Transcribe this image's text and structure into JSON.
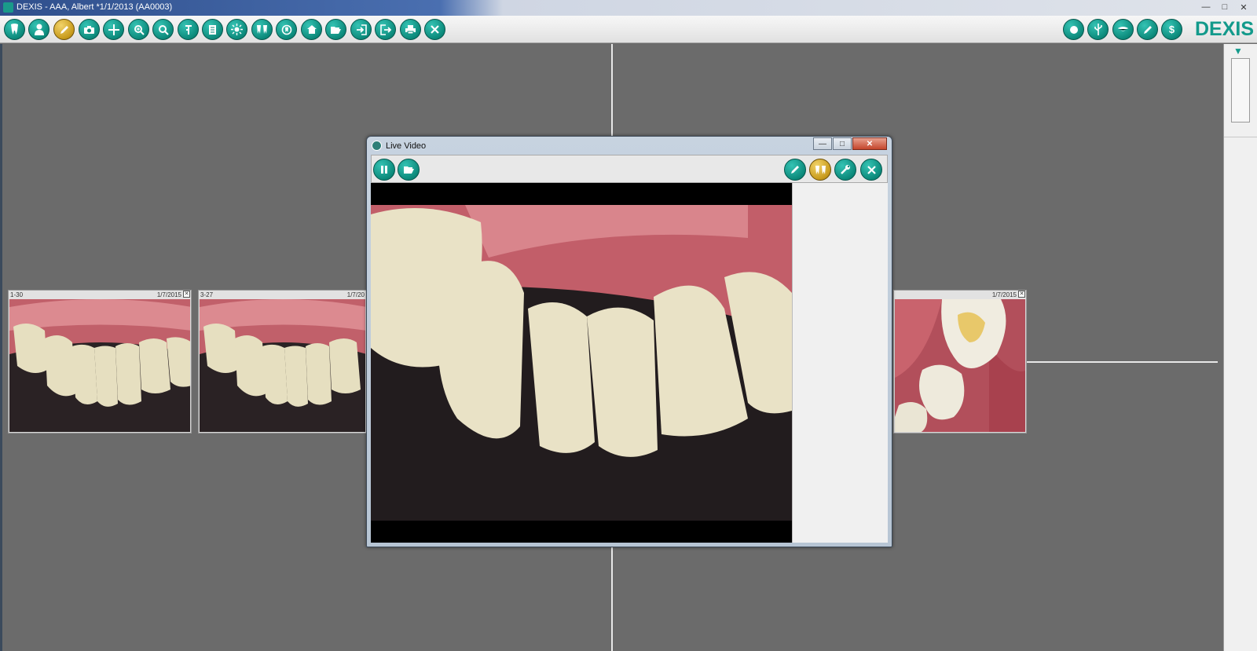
{
  "window": {
    "title": "DEXIS - AAA, Albert *1/1/2013 (AA0003)",
    "controls": [
      "minimize",
      "maximize",
      "close"
    ]
  },
  "toolbar": {
    "buttons": [
      {
        "icon": "tooth-icon"
      },
      {
        "icon": "patient-icon"
      },
      {
        "icon": "annotate-pen-icon",
        "active": true
      },
      {
        "icon": "camera-icon"
      },
      {
        "icon": "crosshair-icon"
      },
      {
        "icon": "zoom-in-icon"
      },
      {
        "icon": "zoom-icon"
      },
      {
        "icon": "measure-icon"
      },
      {
        "icon": "notes-icon"
      },
      {
        "icon": "brightness-icon"
      },
      {
        "icon": "teeth-compare-icon"
      },
      {
        "icon": "tooth-chart-icon"
      },
      {
        "icon": "home-icon"
      },
      {
        "icon": "open-folder-icon"
      },
      {
        "icon": "import-icon"
      },
      {
        "icon": "export-icon"
      },
      {
        "icon": "print-icon"
      },
      {
        "icon": "close-x-icon"
      }
    ],
    "right_buttons": [
      {
        "icon": "record-icon"
      },
      {
        "icon": "usb-icon"
      },
      {
        "icon": "mouth-icon"
      },
      {
        "icon": "edit-pencil-icon"
      },
      {
        "icon": "billing-dollar-icon"
      }
    ],
    "logo": "DEXIS"
  },
  "thumbnails": [
    {
      "label": "1-30",
      "date": "1/7/2015"
    },
    {
      "label": "3-27",
      "date": "1/7/20"
    },
    {
      "label": "",
      "date": "1/7/2015"
    }
  ],
  "live_video": {
    "title": "Live Video",
    "toolbar_left": [
      {
        "icon": "pause-icon"
      },
      {
        "icon": "open-folder-icon"
      }
    ],
    "toolbar_right": [
      {
        "icon": "pen-icon"
      },
      {
        "icon": "teeth-compare-icon"
      },
      {
        "icon": "wrench-icon"
      },
      {
        "icon": "close-x-icon"
      }
    ]
  },
  "colors": {
    "accent": "#139a8b",
    "workspace": "#6b6b6b",
    "gold": "#c79a1b"
  }
}
